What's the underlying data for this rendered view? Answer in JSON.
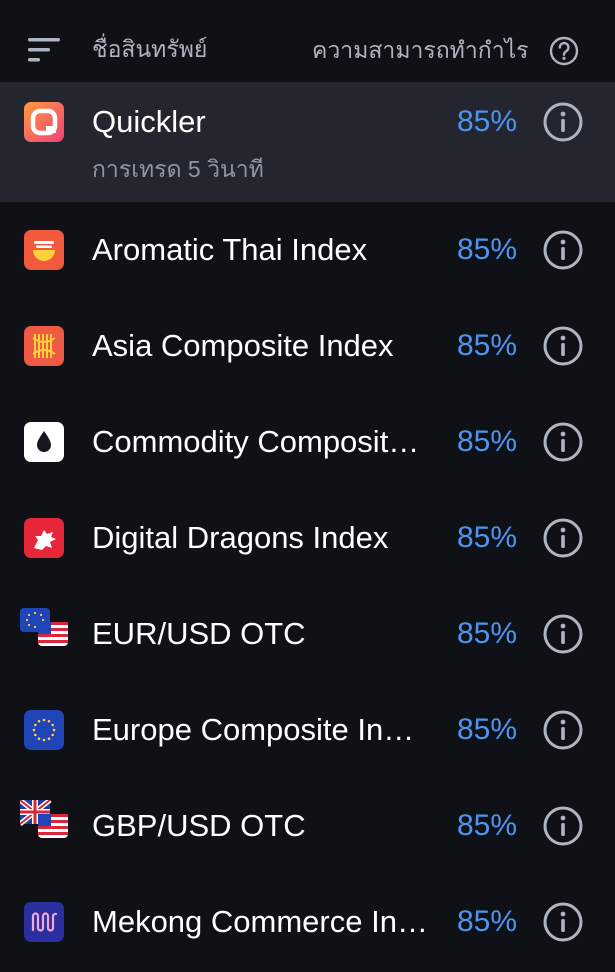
{
  "header": {
    "name_column": "ชื่อสินทรัพย์",
    "profit_column": "ความสามารถทำกำไร"
  },
  "assets": [
    {
      "name": "Quickler",
      "subtitle": "การเทรด 5 วินาที",
      "profit": "85%",
      "icon": "quickler-logo-icon",
      "selected": true
    },
    {
      "name": "Aromatic Thai Index",
      "profit": "85%",
      "icon": "thai-bowl-icon"
    },
    {
      "name": "Asia Composite Index",
      "profit": "85%",
      "icon": "asean-emblem-icon"
    },
    {
      "name": "Commodity Composit…",
      "profit": "85%",
      "icon": "oil-drop-icon"
    },
    {
      "name": "Digital Dragons Index",
      "profit": "85%",
      "icon": "dragon-icon"
    },
    {
      "name": "EUR/USD OTC",
      "profit": "85%",
      "icon": "eur-usd-flags-icon"
    },
    {
      "name": "Europe Composite Ind…",
      "profit": "85%",
      "icon": "eu-flag-icon"
    },
    {
      "name": "GBP/USD OTC",
      "profit": "85%",
      "icon": "gbp-usd-flags-icon"
    },
    {
      "name": "Mekong Commerce In…",
      "profit": "85%",
      "icon": "mekong-wave-icon"
    }
  ],
  "colors": {
    "background": "#101116",
    "selected_row": "#23262e",
    "profit": "#4d93f0",
    "muted_text": "#aeb5c2"
  }
}
